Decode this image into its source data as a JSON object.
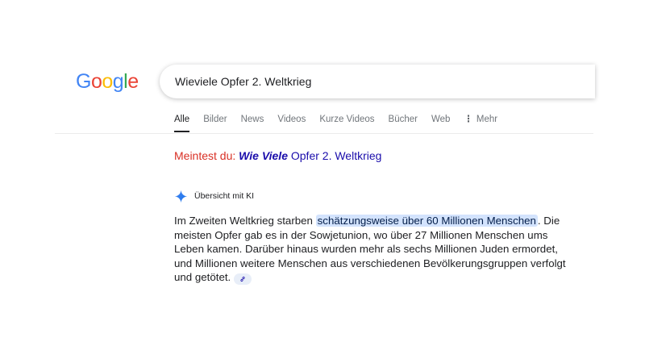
{
  "logo": {
    "letters": [
      "G",
      "o",
      "o",
      "g",
      "l",
      "e"
    ],
    "colors": [
      "#4285f4",
      "#ea4335",
      "#fbbc05",
      "#4285f4",
      "#34a853",
      "#ea4335"
    ]
  },
  "search": {
    "query": "Wieviele Opfer 2. Weltkrieg"
  },
  "tabs": [
    "Alle",
    "Bilder",
    "News",
    "Videos",
    "Kurze Videos",
    "Bücher",
    "Web"
  ],
  "more_tab": {
    "icon": "more-vert-icon",
    "label": "Mehr"
  },
  "did_you_mean": {
    "label": "Meintest du:",
    "corrected": "Wie Viele",
    "rest": "Opfer 2. Weltkrieg"
  },
  "ai_overview": {
    "icon": "sparkle-icon",
    "title": "Übersicht mit KI",
    "text_before": "Im Zweiten Weltkrieg starben",
    "highlight": "schätzungsweise über 60 Millionen Menschen",
    "text_after": ". Die meisten Opfer gab es in der Sowjetunion, wo über 27 Millionen Menschen ums Leben kamen. Darüber hinaus wurden mehr als sechs Millionen Juden ermordet, und Millionen weitere Menschen aus verschiedenen Bevölkerungsgruppen verfolgt und getötet.",
    "link_icon": "link-icon"
  },
  "colors": {
    "accent_blue": "#4285f4",
    "link": "#1a0dab",
    "red": "#d93025",
    "highlight_bg": "#d3e3fd"
  }
}
